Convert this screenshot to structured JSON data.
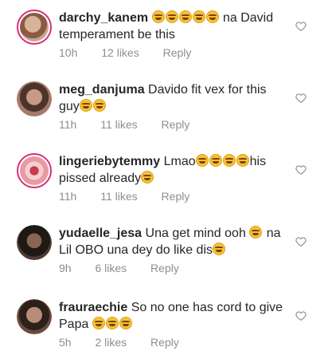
{
  "reply_label": "Reply",
  "comments": [
    {
      "username": "darchy_kanem",
      "text_before": "",
      "emoji_count": 5,
      "text_after": " na David temperament be this",
      "time": "10h",
      "likes": "12 likes",
      "avatar_color": "#c8a58e",
      "story_ring": true
    },
    {
      "username": "meg_danjuma",
      "text_before": "Davido fit vex for this guy",
      "emoji_count": 2,
      "text_after": "",
      "time": "11h",
      "likes": "11 likes",
      "avatar_color": "#a7796a",
      "story_ring": false
    },
    {
      "username": "lingeriebytemmy",
      "text_before": "Lmao",
      "emoji_count": 4,
      "text_after": "his pissed already",
      "time": "11h",
      "likes": "11 likes",
      "avatar_color": "#e79aa2",
      "story_ring": true
    },
    {
      "username": "yudaelle_jesa",
      "text_before": "Una get mind ooh ",
      "emoji_count": 1,
      "text_after": " na Lil OBO una dey do like dis",
      "time": "9h",
      "likes": "6 likes",
      "avatar_color": "#4e3b32",
      "story_ring": false
    },
    {
      "username": "frauraechie",
      "text_before": "So no one has cord to give Papa ",
      "emoji_count": 3,
      "text_after": "",
      "time": "5h",
      "likes": "2 likes",
      "avatar_color": "#6b4a3e",
      "story_ring": false
    }
  ]
}
